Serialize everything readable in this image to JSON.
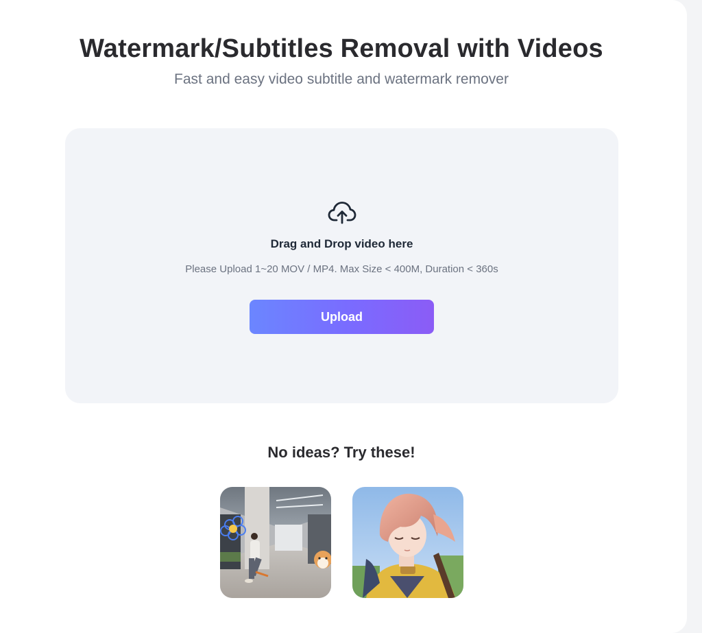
{
  "header": {
    "title": "Watermark/Subtitles Removal with Videos",
    "subtitle": "Fast and easy video subtitle and watermark remover"
  },
  "dropzone": {
    "icon": "cloud-upload-icon",
    "heading": "Drag and Drop video here",
    "hint": "Please Upload 1~20 MOV / MP4. Max Size < 400M, Duration < 360s",
    "button_label": "Upload"
  },
  "samples": {
    "heading": "No ideas? Try these!",
    "items": [
      {
        "name": "sample-video-corridor-dancer"
      },
      {
        "name": "sample-video-anime-character"
      }
    ]
  },
  "colors": {
    "button_gradient_start": "#6b86ff",
    "button_gradient_end": "#8b5cf6",
    "dropzone_bg": "#f2f4f8",
    "title": "#2a2a2e"
  }
}
